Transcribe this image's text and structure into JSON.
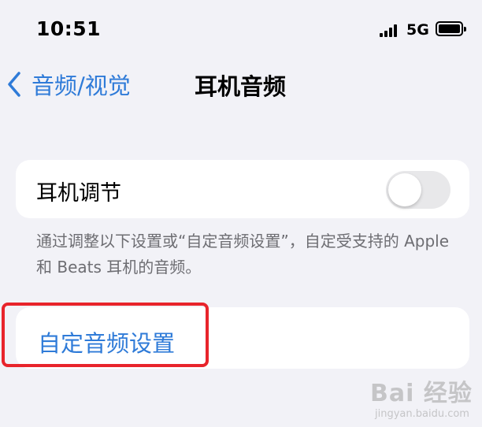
{
  "status_bar": {
    "time": "10:51",
    "network": "5G"
  },
  "nav": {
    "back_label": "音频/视觉",
    "title": "耳机音频"
  },
  "settings": {
    "toggle_row": {
      "label": "耳机调节",
      "enabled": false
    },
    "description": "通过调整以下设置或“自定音频设置”，自定受支持的 Apple 和 Beats 耳机的音频。",
    "link_row": {
      "label": "自定音频设置"
    }
  },
  "watermark": {
    "main": "Bai 经验",
    "sub": "jingyan.baidu.com"
  },
  "colors": {
    "accent": "#2f7bd8",
    "highlight": "#e8242b",
    "background": "#f2f2f7"
  }
}
